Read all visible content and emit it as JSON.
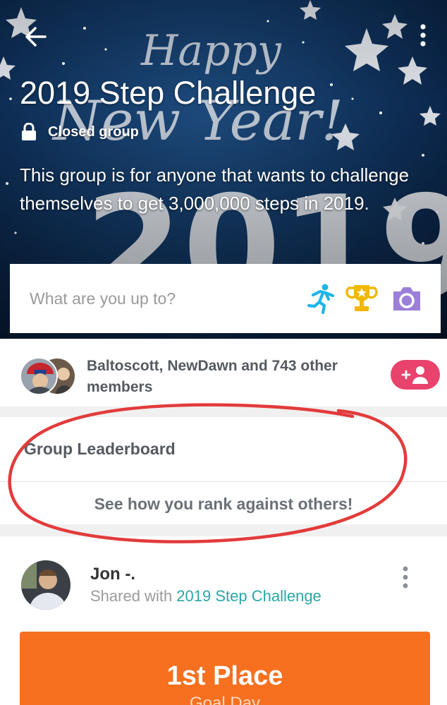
{
  "hero": {
    "background_text": [
      "Happy",
      "New Year!",
      "2019"
    ],
    "group_title": "2019 Step Challenge",
    "privacy_label": "Closed group",
    "description": "This group is for anyone that wants  to challenge themselves to get 3,000,000 steps in 2019.",
    "icons": {
      "back": "back-arrow-icon",
      "more": "more-vertical-icon",
      "lock": "lock-icon"
    }
  },
  "composer": {
    "placeholder": "What are you up to?",
    "actions": [
      {
        "name": "log-activity",
        "icon": "running-figure-icon",
        "color": "#1fb5e6"
      },
      {
        "name": "log-achievement",
        "icon": "trophy-icon",
        "color": "#f2b705"
      },
      {
        "name": "add-photo",
        "icon": "camera-icon",
        "color": "#9b7fd9"
      }
    ]
  },
  "members": {
    "summary": "Baltoscott, NewDawn and 743 other members",
    "join_icon": "add-member-icon",
    "join_color": "#e8426d"
  },
  "leaderboard": {
    "title": "Group Leaderboard",
    "link": "See how you rank against others!",
    "annotation_color": "#e33b3b"
  },
  "post": {
    "author": "Jon -.",
    "shared_prefix": "Shared with ",
    "shared_group": "2019 Step Challenge",
    "card_title": "1st Place",
    "card_subtitle": "Goal Day",
    "card_color": "#f6701f"
  }
}
